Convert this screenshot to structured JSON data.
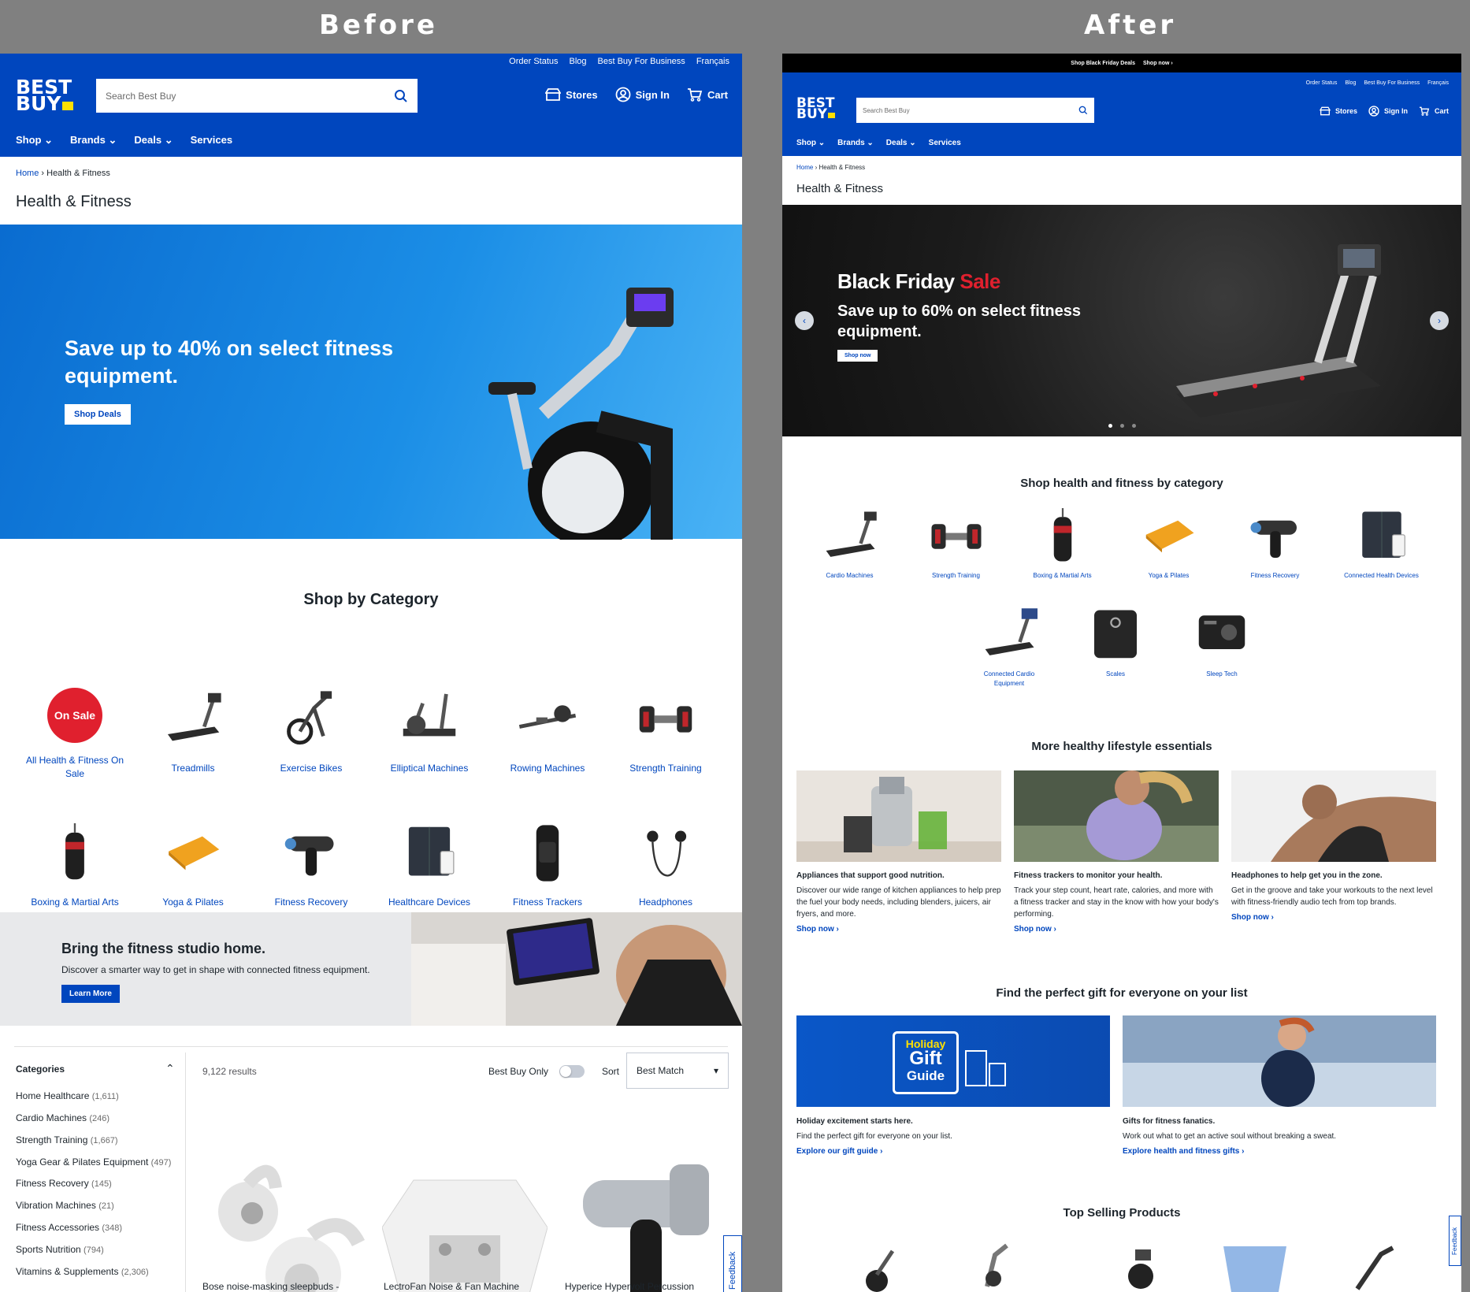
{
  "labels": {
    "before": "Before",
    "after": "After"
  },
  "brand": {
    "line1": "BEST",
    "line2": "BUY",
    "blue": "#0046be",
    "yellow": "#ffe000",
    "red": "#e0202e"
  },
  "utility_links": [
    "Order Status",
    "Blog",
    "Best Buy For Business",
    "Français"
  ],
  "search": {
    "placeholder": "Search Best Buy"
  },
  "header_actions": {
    "stores": "Stores",
    "sign_in": "Sign In",
    "cart": "Cart"
  },
  "nav": [
    "Shop",
    "Brands",
    "Deals",
    "Services"
  ],
  "breadcrumb": {
    "home": "Home",
    "current": "Health & Fitness"
  },
  "page_title": "Health & Fitness",
  "before": {
    "hero": {
      "headline": "Save up to 40% on select fitness equipment.",
      "button": "Shop Deals"
    },
    "shop_by_category": {
      "title": "Shop by Category",
      "items": [
        {
          "label": "All Health & Fitness On Sale",
          "icon": "on-sale-badge",
          "badge": "On Sale"
        },
        {
          "label": "Treadmills",
          "icon": "treadmill-icon"
        },
        {
          "label": "Exercise Bikes",
          "icon": "exercise-bike-icon"
        },
        {
          "label": "Elliptical Machines",
          "icon": "elliptical-icon"
        },
        {
          "label": "Rowing Machines",
          "icon": "rowing-machine-icon"
        },
        {
          "label": "Strength Training",
          "icon": "dumbbell-icon"
        },
        {
          "label": "Boxing & Martial Arts",
          "icon": "punching-bag-icon"
        },
        {
          "label": "Yoga & Pilates",
          "icon": "yoga-mat-icon"
        },
        {
          "label": "Fitness Recovery",
          "icon": "massage-gun-icon"
        },
        {
          "label": "Healthcare Devices",
          "icon": "smart-scale-icon"
        },
        {
          "label": "Fitness Trackers",
          "icon": "fitness-tracker-icon"
        },
        {
          "label": "Headphones",
          "icon": "earbuds-icon"
        }
      ]
    },
    "studio_banner": {
      "title": "Bring the fitness studio home.",
      "text": "Discover a smarter way to get in shape with connected fitness equipment.",
      "button": "Learn More"
    },
    "filters": {
      "title": "Categories",
      "items": [
        {
          "label": "Home Healthcare",
          "count": "(1,611)"
        },
        {
          "label": "Cardio Machines",
          "count": "(246)"
        },
        {
          "label": "Strength Training",
          "count": "(1,667)"
        },
        {
          "label": "Yoga Gear & Pilates Equipment",
          "count": "(497)"
        },
        {
          "label": "Fitness Recovery",
          "count": "(145)"
        },
        {
          "label": "Vibration Machines",
          "count": "(21)"
        },
        {
          "label": "Fitness Accessories",
          "count": "(348)"
        },
        {
          "label": "Sports Nutrition",
          "count": "(794)"
        },
        {
          "label": "Vitamins & Supplements",
          "count": "(2,306)"
        }
      ]
    },
    "results": {
      "count": "9,122 results",
      "toggle_label": "Best Buy Only",
      "sort_label": "Sort",
      "sort_value": "Best Match"
    },
    "products": [
      "Bose noise-masking sleepbuds -",
      "LectroFan Noise & Fan Machine",
      "Hyperice Hypervolt Percussion"
    ],
    "feedback": "Feedback"
  },
  "after": {
    "promo_bar": {
      "text": "Shop Black Friday Deals",
      "link": "Shop now ›"
    },
    "hero": {
      "title_a": "Black Friday",
      "title_b": "Sale",
      "headline": "Save up to 60% on select fitness equipment.",
      "button": "Shop now",
      "slide_dots": 3,
      "active_dot": 1
    },
    "categories": {
      "title": "Shop health and fitness by category",
      "items": [
        {
          "label": "Cardio Machines",
          "icon": "treadmill-icon"
        },
        {
          "label": "Strength Training",
          "icon": "dumbbell-icon"
        },
        {
          "label": "Boxing & Martial Arts",
          "icon": "punching-bag-icon"
        },
        {
          "label": "Yoga & Pilates",
          "icon": "yoga-mat-icon"
        },
        {
          "label": "Fitness Recovery",
          "icon": "massage-gun-icon"
        },
        {
          "label": "Connected Health Devices",
          "icon": "smart-scale-icon"
        },
        {
          "label": "Connected Cardio Equipment",
          "icon": "connected-treadmill-icon"
        },
        {
          "label": "Scales",
          "icon": "scale-icon"
        },
        {
          "label": "Sleep Tech",
          "icon": "sleep-device-icon"
        }
      ]
    },
    "essentials": {
      "title": "More healthy lifestyle essentials",
      "items": [
        {
          "title": "Appliances that support good nutrition.",
          "text": "Discover our wide range of kitchen appliances to help prep the fuel your body needs, including blenders, juicers, air fryers, and more.",
          "link": "Shop now ›"
        },
        {
          "title": "Fitness trackers to monitor your health.",
          "text": "Track your step count, heart rate, calories, and more with a fitness tracker and stay in the know with how your body's performing.",
          "link": "Shop now ›"
        },
        {
          "title": "Headphones to help get you in the zone.",
          "text": "Get in the groove and take your workouts to the next level with fitness-friendly audio tech from top brands.",
          "link": "Shop now ›"
        }
      ]
    },
    "gifts": {
      "title": "Find the perfect gift for everyone on your list",
      "gift_art": {
        "line1": "Holiday",
        "line2": "Gift",
        "line3": "Guide"
      },
      "items": [
        {
          "title": "Holiday excitement starts here.",
          "text": "Find the perfect gift for everyone on your list.",
          "link": "Explore our gift guide ›"
        },
        {
          "title": "Gifts for fitness fanatics.",
          "text": "Work out what to get an active soul without breaking a sweat.",
          "link": "Explore health and fitness gifts ›"
        }
      ]
    },
    "top_selling": {
      "title": "Top Selling Products"
    },
    "feedback": "Feedback"
  }
}
